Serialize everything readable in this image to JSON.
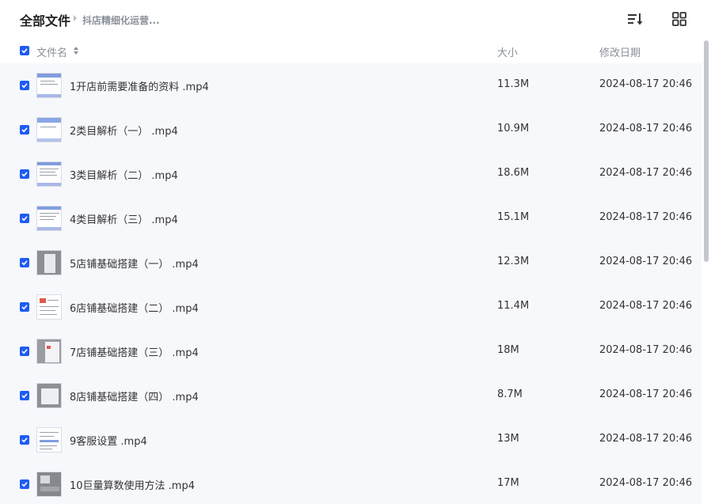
{
  "breadcrumb": {
    "root": "全部文件",
    "current": "抖店精细化运营..."
  },
  "toolbar": {
    "sort_icon": "sort-list-icon",
    "view_icon": "grid-view-icon"
  },
  "columns": {
    "name": "文件名",
    "size": "大小",
    "modified": "修改日期"
  },
  "files": [
    {
      "name": "1开店前需要准备的资料 .mp4",
      "size": "11.3M",
      "date": "2024-08-17 20:46",
      "checked": true
    },
    {
      "name": "2类目解析（一） .mp4",
      "size": "10.9M",
      "date": "2024-08-17 20:46",
      "checked": true
    },
    {
      "name": "3类目解析（二） .mp4",
      "size": "18.6M",
      "date": "2024-08-17 20:46",
      "checked": true
    },
    {
      "name": "4类目解析（三） .mp4",
      "size": "15.1M",
      "date": "2024-08-17 20:46",
      "checked": true
    },
    {
      "name": "5店铺基础搭建（一） .mp4",
      "size": "12.3M",
      "date": "2024-08-17 20:46",
      "checked": true
    },
    {
      "name": "6店铺基础搭建（二） .mp4",
      "size": "11.4M",
      "date": "2024-08-17 20:46",
      "checked": true
    },
    {
      "name": "7店铺基础搭建（三） .mp4",
      "size": "18M",
      "date": "2024-08-17 20:46",
      "checked": true
    },
    {
      "name": "8店铺基础搭建（四） .mp4",
      "size": "8.7M",
      "date": "2024-08-17 20:46",
      "checked": true
    },
    {
      "name": "9客服设置 .mp4",
      "size": "13M",
      "date": "2024-08-17 20:46",
      "checked": true
    },
    {
      "name": "10巨量算数使用方法 .mp4",
      "size": "17M",
      "date": "2024-08-17 20:46",
      "checked": true
    }
  ],
  "colors": {
    "accent": "#1f5cf5",
    "list_background": "#f7f8fc",
    "muted_text": "#8a8f99"
  }
}
